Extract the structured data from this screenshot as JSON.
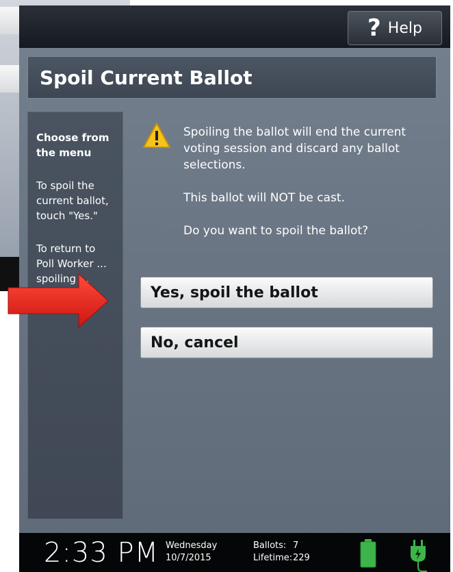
{
  "help_button": {
    "label": "Help",
    "glyph": "?"
  },
  "title": "Spoil Current Ballot",
  "sidebar": {
    "heading": "Choose from the menu",
    "paragraphs": [
      "To spoil the current ballot, touch \"Yes.\"",
      "To return to Poll Worker ... spoiling ... ballot, touch \"No.\""
    ]
  },
  "message": {
    "warning": "Spoiling the ballot will end the current voting session and discard any ballot selections.",
    "not_cast": "This ballot will NOT be cast.",
    "question": "Do you want to spoil the ballot?"
  },
  "buttons": {
    "yes": "Yes, spoil the ballot",
    "no": "No, cancel"
  },
  "status": {
    "time": "2:33 PM",
    "day": "Wednesday",
    "date": "10/7/2015",
    "ballots_label": "Ballots:",
    "ballots_value": "7",
    "lifetime_label": "Lifetime:",
    "lifetime_value": "229"
  },
  "colors": {
    "accent_arrow": "#e8231d",
    "battery": "#3db54a",
    "warning": "#f6c21c"
  },
  "icons": [
    "help-icon",
    "warning-icon",
    "battery-icon",
    "power-plug-icon",
    "red-arrow-annotation"
  ]
}
